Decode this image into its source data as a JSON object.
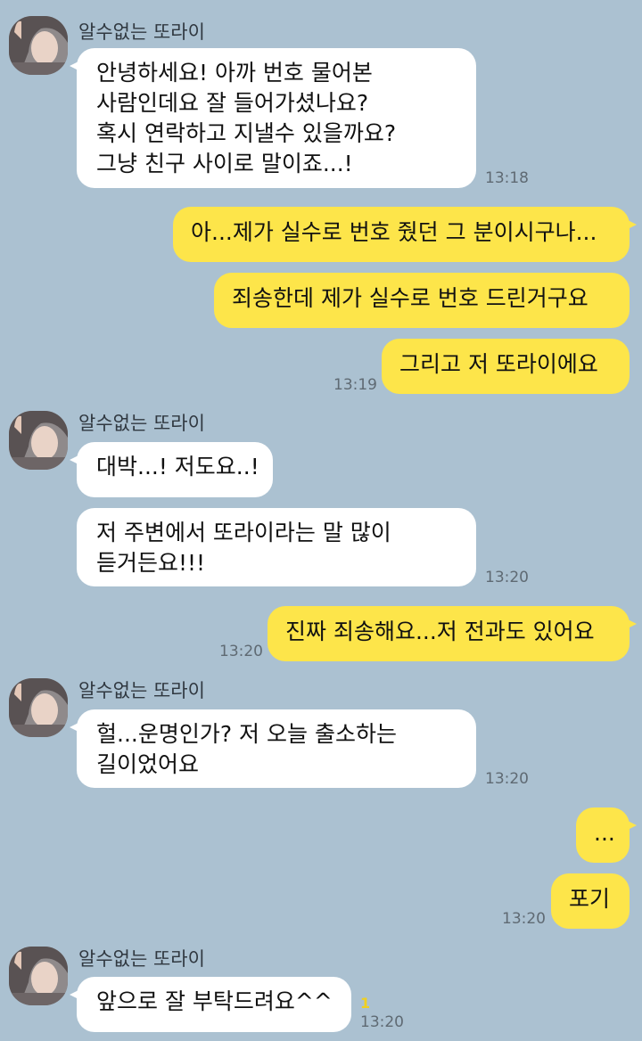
{
  "contact_name": "알수없는 또라이",
  "messages": [
    {
      "text": "안녕하세요! 아까 번호 물어본\n사람인데요 잘 들어가셨나요?\n혹시 연락하고 지낼수 있을까요?\n그냥 친구 사이로 말이죠...!",
      "time": "13:18"
    },
    {
      "text": "아...제가 실수로 번호 줬던 그 분이시구나..."
    },
    {
      "text": "죄송한데 제가 실수로 번호 드린거구요"
    },
    {
      "text": "그리고 저 또라이에요",
      "time": "13:19"
    },
    {
      "text": "대박...! 저도요..!"
    },
    {
      "text": "저 주변에서 또라이라는 말 많이\n듣거든요!!!",
      "time": "13:20"
    },
    {
      "text": "진짜 죄송해요...저 전과도 있어요",
      "time": "13:20"
    },
    {
      "text": "헐...운명인가? 저 오늘 출소하는\n길이었어요",
      "time": "13:20"
    },
    {
      "text": "..."
    },
    {
      "text": "포기",
      "time": "13:20"
    },
    {
      "text": "앞으로 잘 부탁드려요^^",
      "time": "13:20",
      "unread": "1"
    }
  ],
  "colors": {
    "background": "#abc1d1",
    "incoming_bubble": "#ffffff",
    "outgoing_bubble": "#fde54a",
    "timestamp": "#5f6a73",
    "unread_badge": "#f0d020"
  },
  "icons": {
    "avatar": "contact-profile-photo-icon"
  }
}
